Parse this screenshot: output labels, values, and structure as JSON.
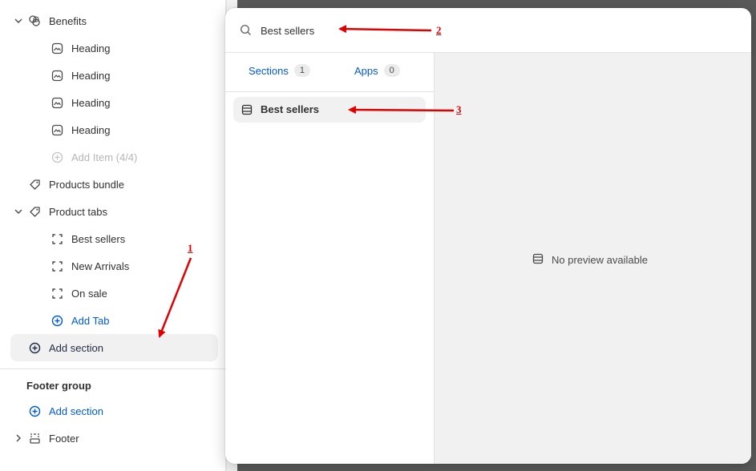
{
  "sidebar": {
    "benefits": {
      "label": "Benefits",
      "items": [
        {
          "label": "Heading"
        },
        {
          "label": "Heading"
        },
        {
          "label": "Heading"
        },
        {
          "label": "Heading"
        }
      ],
      "add_item_label": "Add Item (4/4)"
    },
    "products_bundle": {
      "label": "Products bundle"
    },
    "product_tabs": {
      "label": "Product tabs",
      "items": [
        {
          "label": "Best sellers"
        },
        {
          "label": "New Arrivals"
        },
        {
          "label": "On sale"
        }
      ],
      "add_tab_label": "Add Tab"
    },
    "add_section_label": "Add section",
    "footer_group": {
      "title": "Footer group",
      "add_section_label": "Add section",
      "footer_label": "Footer"
    }
  },
  "popover": {
    "search": {
      "value": "Best sellers"
    },
    "tabs": [
      {
        "label": "Sections",
        "count": "1"
      },
      {
        "label": "Apps",
        "count": "0"
      }
    ],
    "result": {
      "label": "Best sellers"
    },
    "preview": {
      "label": "No preview available"
    }
  },
  "annotations": {
    "n1": "1",
    "n2": "2",
    "n3": "3"
  },
  "colors": {
    "accent": "#005bd3",
    "annotation": "#e00000",
    "canvas": "#5a5a5a"
  },
  "icons": {
    "benefits": "shapes-icon",
    "heading": "image-heading-icon",
    "add": "plus-circle-icon",
    "tag": "tag-icon",
    "tab_block": "dashed-square-icon",
    "footer": "footer-layout-icon",
    "search": "search-icon",
    "section": "section-icon"
  }
}
